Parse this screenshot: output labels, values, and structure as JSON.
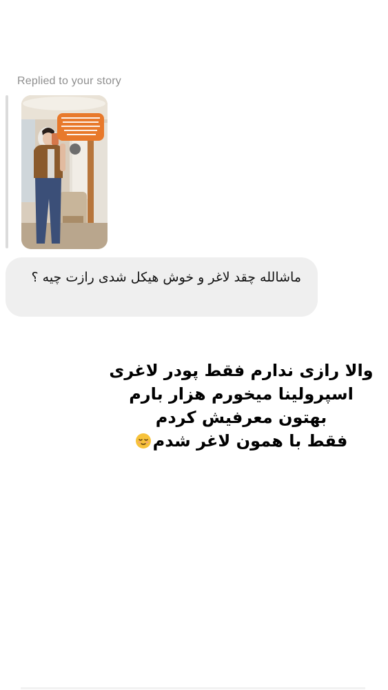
{
  "reply": {
    "label": "Replied to your story"
  },
  "story": {
    "thumbnail_icon": "story-photo-thumbnail",
    "sticker_accent": "#e8792b"
  },
  "message": {
    "text": "ماشالله چقد لاغر و خوش هیکل شدی رازت چیه ؟"
  },
  "caption": {
    "line1": "والا رازی ندارم فقط پودر لاغری",
    "line2": "اسپرولینا میخورم هزار بارم",
    "line3": "بهتون معرفیش کردم",
    "line4": "فقط با همون لاغر شدم",
    "emoji_icon": "relieved-face-emoji"
  },
  "colors": {
    "bubble_bg": "#efefef",
    "label_gray": "#8e8e8e",
    "text": "#111111"
  }
}
